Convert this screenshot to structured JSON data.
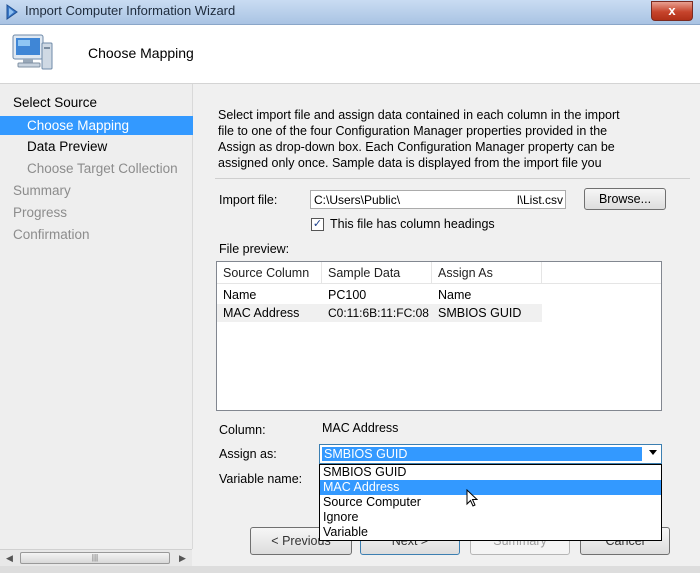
{
  "window": {
    "title": "Import Computer Information Wizard",
    "close_glyph": "x"
  },
  "header": {
    "title": "Choose Mapping",
    "icon": "computer-icon"
  },
  "nav": {
    "items": [
      {
        "label": "Select Source"
      },
      {
        "label": "Choose Mapping"
      },
      {
        "label": "Data Preview"
      },
      {
        "label": "Choose Target Collection"
      },
      {
        "label": "Summary"
      },
      {
        "label": "Progress"
      },
      {
        "label": "Confirmation"
      }
    ]
  },
  "description": {
    "line1": "Select import file and assign data contained in each column in the import",
    "line2": "file to one of the four Configuration Manager properties provided in the",
    "line3": "Assign as drop-down box. Each Configuration Manager property can be",
    "line4": "assigned only once. Sample data is displayed from the import file you"
  },
  "import_file": {
    "label": "Import file:",
    "value_left": "C:\\Users\\Public\\",
    "value_right": "l\\List.csv",
    "browse_label": "Browse..."
  },
  "headings_checkbox": {
    "label": "This file has column headings",
    "checked": true,
    "mark": "✓"
  },
  "preview": {
    "label": "File preview:",
    "columns": [
      "Source Column",
      "Sample Data",
      "Assign As"
    ],
    "rows": [
      [
        "Name",
        "PC100",
        "Name"
      ],
      [
        "MAC Address",
        "C0:11:6B:11:FC:08",
        "SMBIOS GUID"
      ]
    ]
  },
  "column": {
    "label": "Column:",
    "value": "MAC Address"
  },
  "assign_as": {
    "label": "Assign as:",
    "selected": "SMBIOS GUID",
    "options": [
      "SMBIOS GUID",
      "MAC Address",
      "Source Computer",
      "Ignore",
      "Variable"
    ],
    "highlighted_index": 1
  },
  "variable_name": {
    "label": "Variable name:"
  },
  "buttons": {
    "previous": "< Previous",
    "next": "Next >",
    "summary": "Summary",
    "cancel": "Cancel"
  },
  "colors": {
    "selection": "#3399ff",
    "title_bar": "#b9d1ee",
    "close": "#c6442c"
  }
}
